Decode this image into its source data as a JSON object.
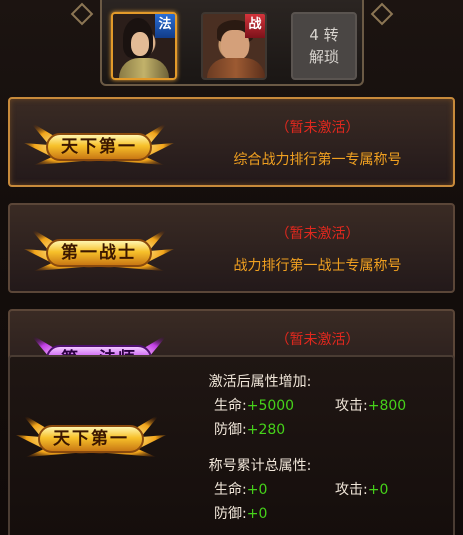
{
  "characters": [
    {
      "badge": "法",
      "selected": true
    },
    {
      "badge": "战",
      "selected": false
    }
  ],
  "locked_slot": {
    "line1": "4 转",
    "line2": "解琐"
  },
  "titles": [
    {
      "emblem": "天下第一",
      "status": "（暂未激活）",
      "desc": "综合战力排行第一专属称号",
      "active": true,
      "color": "#f7c12a"
    },
    {
      "emblem": "第一战士",
      "status": "（暂未激活）",
      "desc": "战力排行第一战士专属称号",
      "active": false,
      "color": "#f7c12a"
    },
    {
      "emblem": "第一法师",
      "status": "（暂未激活）",
      "desc": "",
      "active": false,
      "color": "#c54bf0"
    }
  ],
  "tooltip": {
    "emblem": "天下第一",
    "after_heading": "激活后属性增加:",
    "after": {
      "hp_label": "生命:",
      "hp_value": "+5000",
      "atk_label": "攻击:",
      "atk_value": "+800",
      "def_label": "防御:",
      "def_value": "+280"
    },
    "total_heading": "称号累计总属性:",
    "total": {
      "hp_label": "生命:",
      "hp_value": "+0",
      "atk_label": "攻击:",
      "atk_value": "+0",
      "def_label": "防御:",
      "def_value": "+0"
    }
  },
  "colors": {
    "status": "#e0281e",
    "desc": "#f0a020",
    "value": "#46d21a",
    "gold_border": "#c78a3b"
  }
}
